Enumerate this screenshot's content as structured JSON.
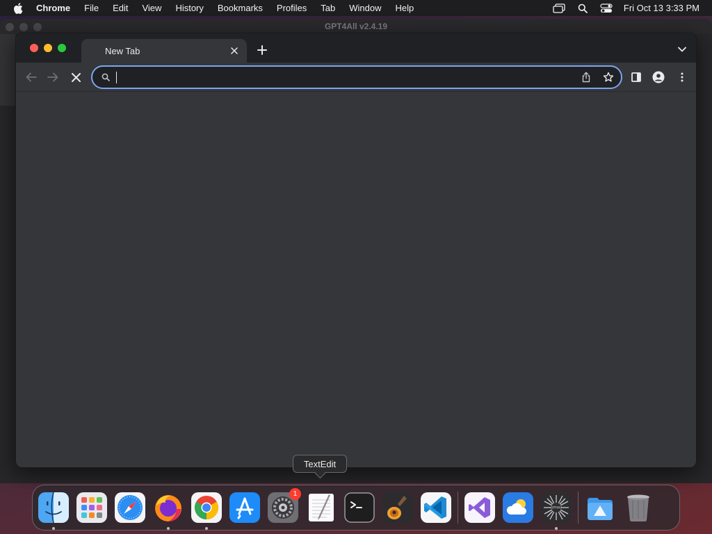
{
  "menubar": {
    "apple_icon": "apple-logo-icon",
    "app_name": "Chrome",
    "items": [
      "File",
      "Edit",
      "View",
      "History",
      "Bookmarks",
      "Profiles",
      "Tab",
      "Window",
      "Help"
    ],
    "status_icons": [
      "screen-mirroring-icon",
      "spotlight-search-icon",
      "control-center-icon"
    ],
    "clock": "Fri Oct 13  3:33 PM"
  },
  "background_window": {
    "title": "GPT4All v2.4.19"
  },
  "chrome": {
    "tab": {
      "title": "New Tab",
      "close_icon": "close-icon"
    },
    "new_tab_icon": "plus-icon",
    "tab_search_icon": "chevron-down-icon",
    "toolbar": {
      "back_icon": "arrow-left-icon",
      "forward_icon": "arrow-right-icon",
      "stop_icon": "close-icon",
      "omnibox_value": "",
      "omnibox_placeholder": "",
      "share_icon": "share-icon",
      "bookmark_icon": "star-icon",
      "side_panel_icon": "side-panel-icon",
      "profile_icon": "person-icon",
      "menu_icon": "kebab-menu-icon"
    },
    "colors": {
      "frame": "#202124",
      "toolbar": "#35363a",
      "omnibox_focus": "#7aa6f0"
    }
  },
  "tooltip": {
    "text": "TextEdit"
  },
  "dock": {
    "apps": [
      {
        "name": "Finder",
        "icon": "finder-icon",
        "running": true
      },
      {
        "name": "Launchpad",
        "icon": "launchpad-icon",
        "running": false
      },
      {
        "name": "Safari",
        "icon": "safari-icon",
        "running": false
      },
      {
        "name": "Firefox",
        "icon": "firefox-icon",
        "running": true
      },
      {
        "name": "Google Chrome",
        "icon": "chrome-icon",
        "running": true
      },
      {
        "name": "App Store",
        "icon": "app-store-icon",
        "running": false
      },
      {
        "name": "System Preferences",
        "icon": "system-preferences-icon",
        "running": false,
        "badge": "1"
      },
      {
        "name": "TextEdit",
        "icon": "textedit-icon",
        "running": false
      },
      {
        "name": "Terminal",
        "icon": "terminal-icon",
        "running": false
      },
      {
        "name": "GarageBand",
        "icon": "garageband-icon",
        "running": false
      },
      {
        "name": "Visual Studio Code",
        "icon": "vscode-icon",
        "running": false
      }
    ],
    "recent_apps": [
      {
        "name": "Visual Studio",
        "icon": "visual-studio-icon",
        "running": false
      },
      {
        "name": "Weather",
        "icon": "weather-icon",
        "running": false
      },
      {
        "name": "GPT4All",
        "icon": "gpt4all-icon",
        "running": true
      }
    ],
    "trailing": [
      {
        "name": "Downloads",
        "icon": "downloads-folder-icon"
      },
      {
        "name": "Trash",
        "icon": "trash-icon"
      }
    ]
  }
}
